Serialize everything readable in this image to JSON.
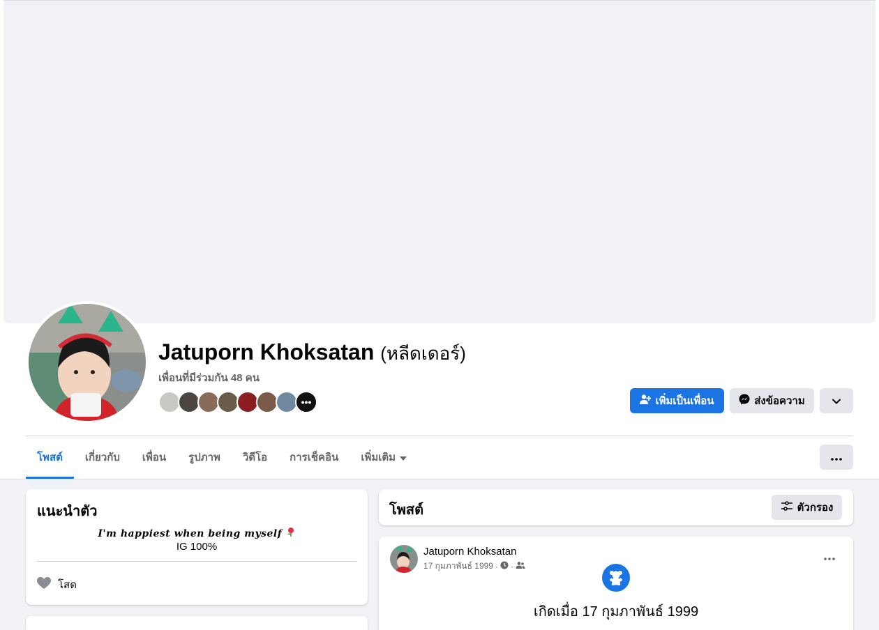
{
  "profile": {
    "name": "Jatuporn Khoksatan",
    "alternate_name": "(หลีดเดอร์)",
    "mutual_friends": "เพื่อนที่มีร่วมกัน 48 คน",
    "more_faces_glyph": "•••"
  },
  "actions": {
    "add_friend": "เพิ่มเป็นเพื่อน",
    "message": "ส่งข้อความ"
  },
  "tabs": [
    {
      "label": "โพสต์",
      "active": true
    },
    {
      "label": "เกี่ยวกับ",
      "active": false
    },
    {
      "label": "เพื่อน",
      "active": false
    },
    {
      "label": "รูปภาพ",
      "active": false
    },
    {
      "label": "วิดีโอ",
      "active": false
    },
    {
      "label": "การเช็คอิน",
      "active": false
    },
    {
      "label": "เพิ่มเติม",
      "active": false
    }
  ],
  "intro": {
    "title": "แนะนำตัว",
    "bio_line1": "𝑰'𝒎 𝒉𝒂𝒑𝒑𝒊𝒆𝒔𝒕 𝒘𝒉𝒆𝒏 𝒃𝒆𝒊𝒏𝒈 𝒎𝒚𝒔𝒆𝒍𝒇",
    "bio_line2": "IG 100%",
    "relationship": "โสด"
  },
  "posts": {
    "title": "โพสต์",
    "filter": "ตัวกรอง"
  },
  "post": {
    "author": "Jatuporn Khoksatan",
    "date": "17 กุมภาพันธ์ 1999",
    "life_event": "เกิดเมื่อ 17 กุมภาพันธ์ 1999"
  },
  "colors": {
    "accent": "#1b74e4",
    "page_bg": "#f0f2f5",
    "secondary_text": "#65676b",
    "button_gray": "#e4e6eb"
  },
  "icons": {
    "add_friend": "person-plus-icon",
    "message": "messenger-icon",
    "more": "chevron-down-icon",
    "tab_more": "ellipsis-icon",
    "filter": "sliders-icon",
    "relationship": "heart-icon",
    "life_event": "teddy-bear-icon",
    "privacy": "friends-icon"
  }
}
